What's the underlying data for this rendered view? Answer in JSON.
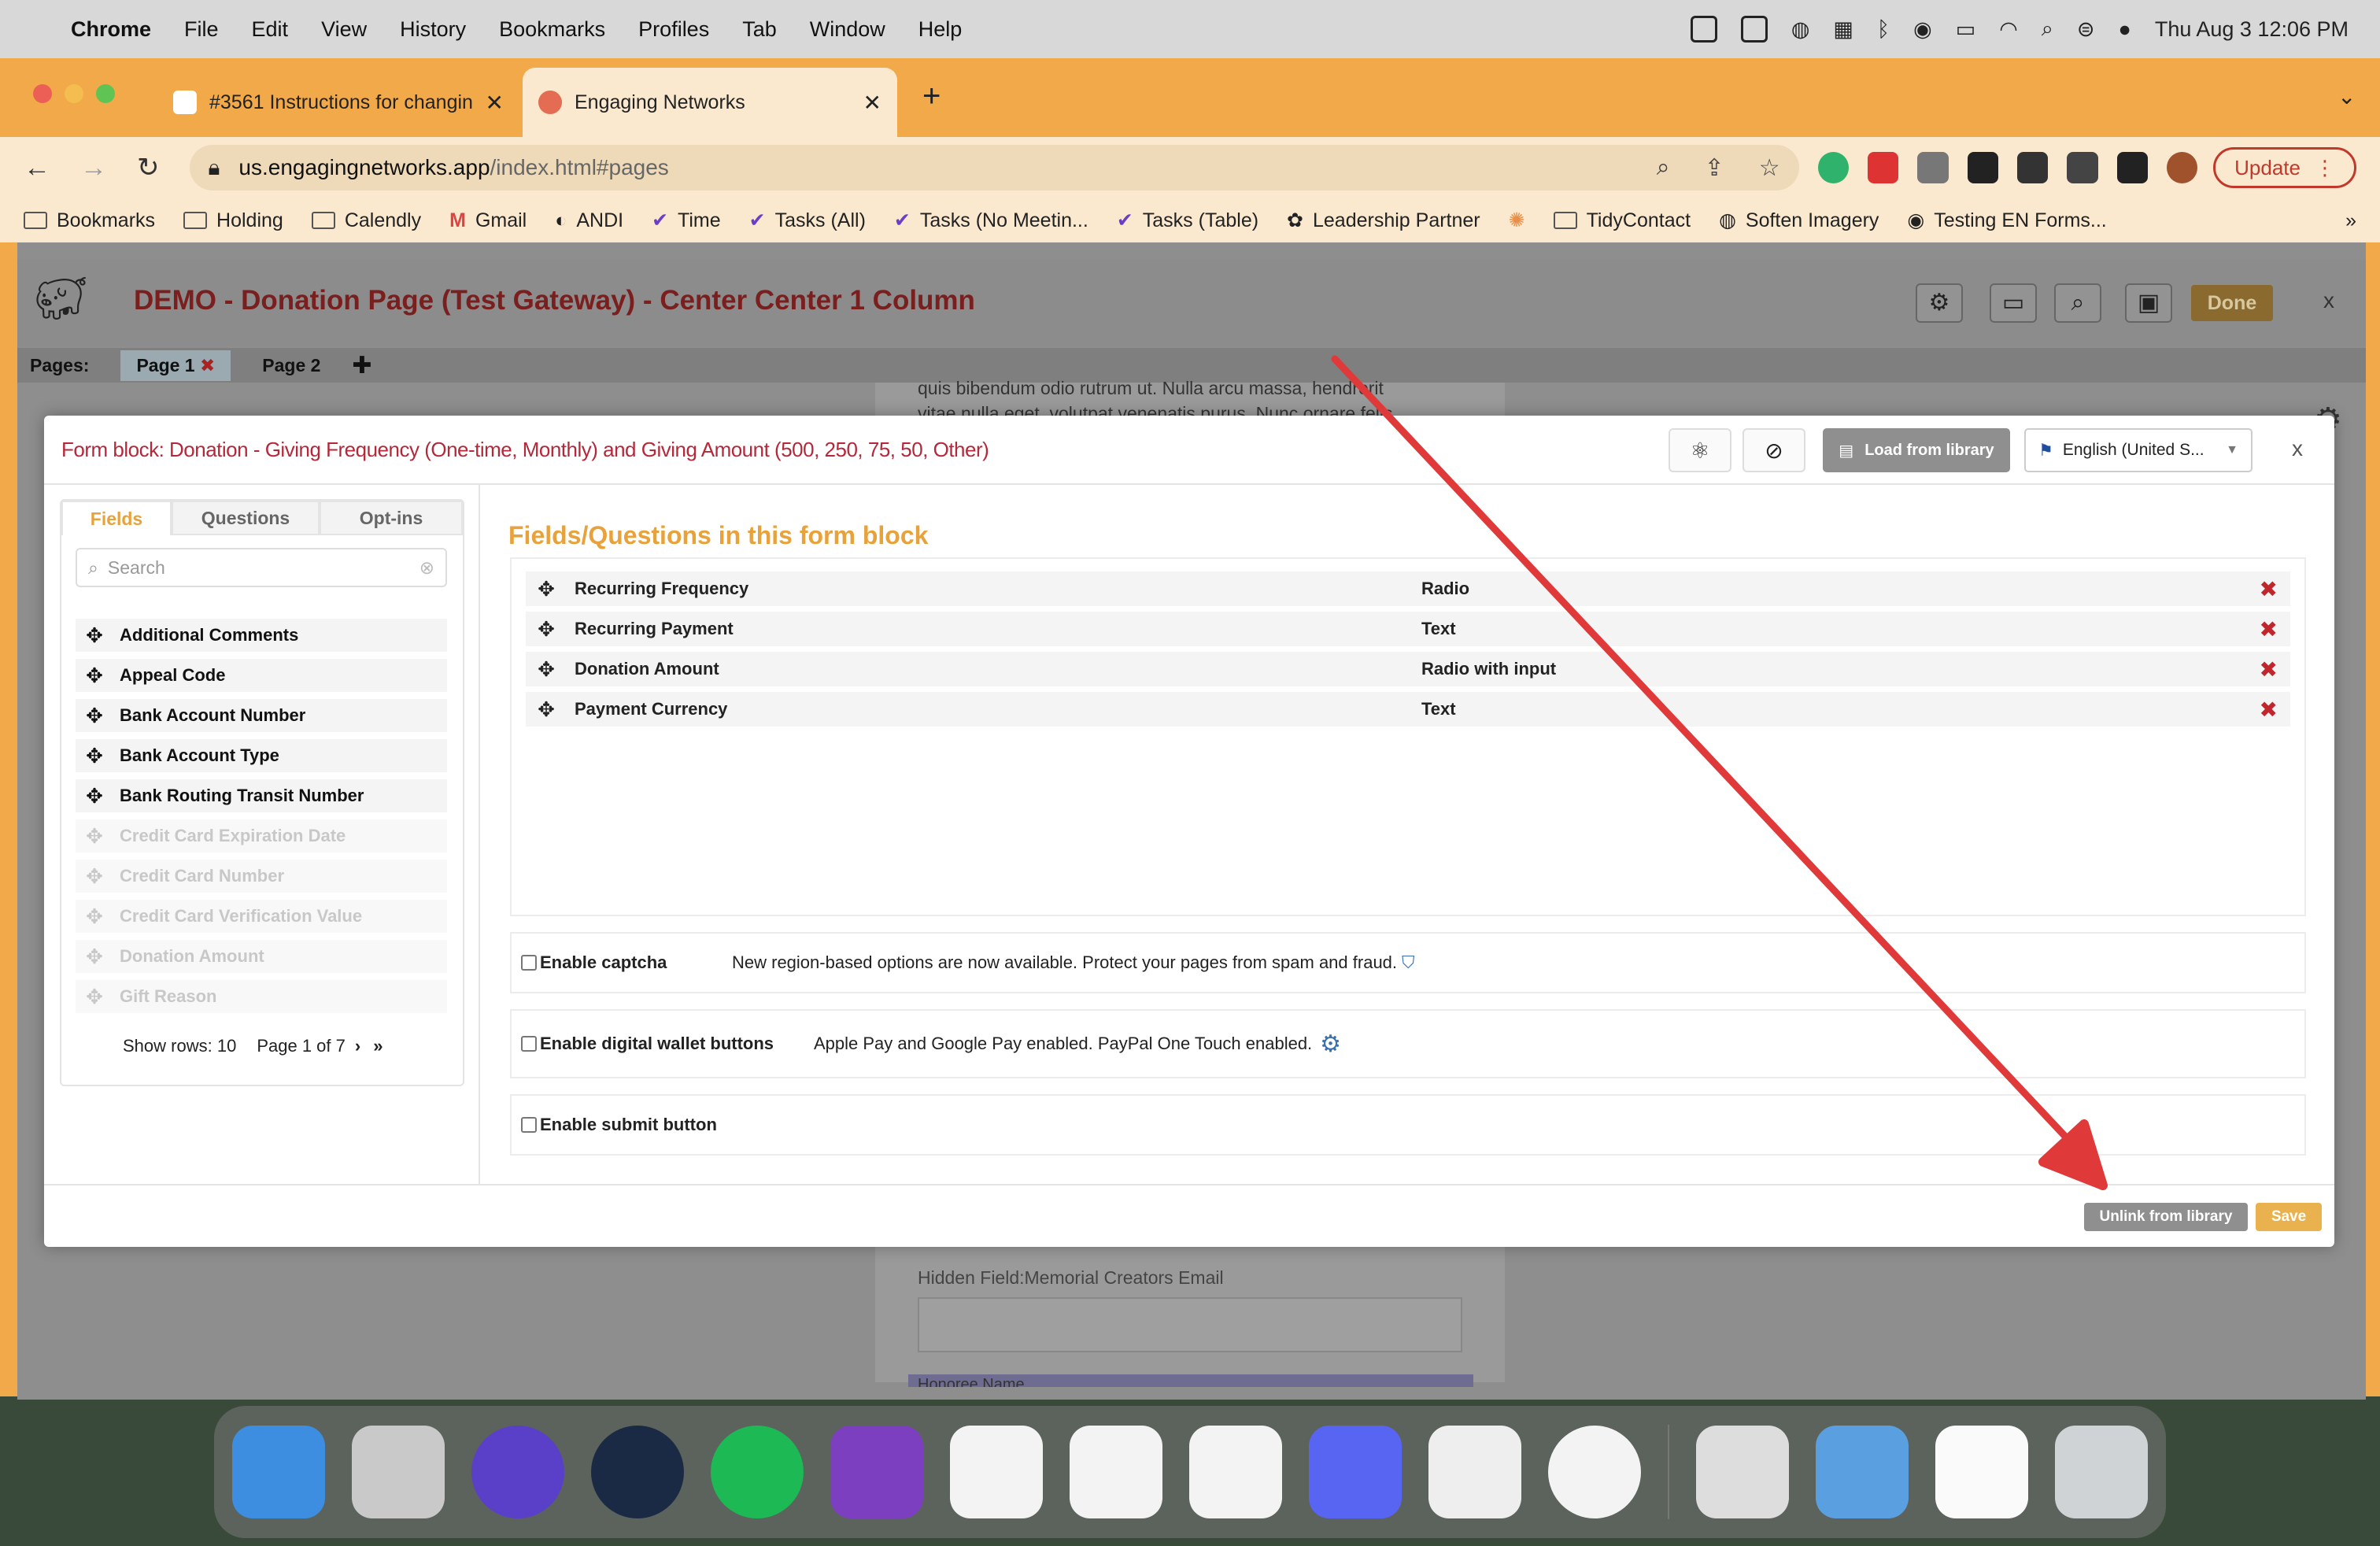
{
  "menubar": {
    "app": "Chrome",
    "items": [
      "File",
      "Edit",
      "View",
      "History",
      "Bookmarks",
      "Profiles",
      "Tab",
      "Window",
      "Help"
    ],
    "clock": "Thu Aug 3  12:06 PM"
  },
  "tabs": [
    {
      "title": "#3561 Instructions for changin"
    },
    {
      "title": "Engaging Networks"
    }
  ],
  "url": {
    "domain": "us.engagingnetworks.app",
    "path": "/index.html#pages"
  },
  "update_label": "Update",
  "bookmarks": [
    "Bookmarks",
    "Holding",
    "Calendly",
    "Gmail",
    "ANDI",
    "Time",
    "Tasks (All)",
    "Tasks (No Meetin...",
    "Tasks (Table)",
    "Leadership Partner",
    "TidyContact",
    "Soften Imagery",
    "Testing EN Forms..."
  ],
  "app": {
    "title": "DEMO - Donation Page (Test Gateway) - Center Center 1 Column",
    "pages_label": "Pages:",
    "page1": "Page 1",
    "page2": "Page 2",
    "done": "Done",
    "bg_text1": "quis bibendum odio rutrum ut. Nulla arcu massa, hendrerit",
    "bg_text2": "vitae nulla eget, volutpat venenatis purus. Nunc ornare felis",
    "bg_field": "Hidden Field:Memorial Creators Email",
    "bg_field2": "Honoree Name"
  },
  "modal": {
    "title": "Form block: Donation - Giving Frequency (One-time, Monthly) and Giving Amount (500, 250, 75, 50, Other)",
    "load_from_library": "Load from library",
    "language": "English (United S...",
    "close": "x",
    "tabs": [
      "Fields",
      "Questions",
      "Opt-ins"
    ],
    "search_placeholder": "Search",
    "fields": [
      {
        "label": "Additional Comments"
      },
      {
        "label": "Appeal Code"
      },
      {
        "label": "Bank Account Number"
      },
      {
        "label": "Bank Account Type"
      },
      {
        "label": "Bank Routing Transit Number"
      },
      {
        "label": "Credit Card Expiration Date"
      },
      {
        "label": "Credit Card Number"
      },
      {
        "label": "Credit Card Verification Value"
      },
      {
        "label": "Donation Amount"
      },
      {
        "label": "Gift Reason"
      }
    ],
    "pager": {
      "show_rows": "Show rows:",
      "rows": "10",
      "page": "Page 1 of 7"
    },
    "section_title": "Fields/Questions in this form block",
    "rows": [
      {
        "name": "Recurring Frequency",
        "type": "Radio"
      },
      {
        "name": "Recurring Payment",
        "type": "Text"
      },
      {
        "name": "Donation Amount",
        "type": "Radio with input"
      },
      {
        "name": "Payment Currency",
        "type": "Text"
      }
    ],
    "captcha": {
      "label": "Enable captcha",
      "desc": "New region-based options are now available. Protect your pages from spam and fraud."
    },
    "wallet": {
      "label": "Enable digital wallet buttons",
      "desc": "Apple Pay and Google Pay enabled. PayPal One Touch enabled."
    },
    "submit": {
      "label": "Enable submit button"
    },
    "unlink": "Unlink from library",
    "save": "Save"
  },
  "colors": {
    "accent": "#e8a23b",
    "title_red": "#b4283a",
    "delete_red": "#c0262c",
    "chrome_orange": "#f2a94a",
    "arrow": "#e0393a"
  }
}
